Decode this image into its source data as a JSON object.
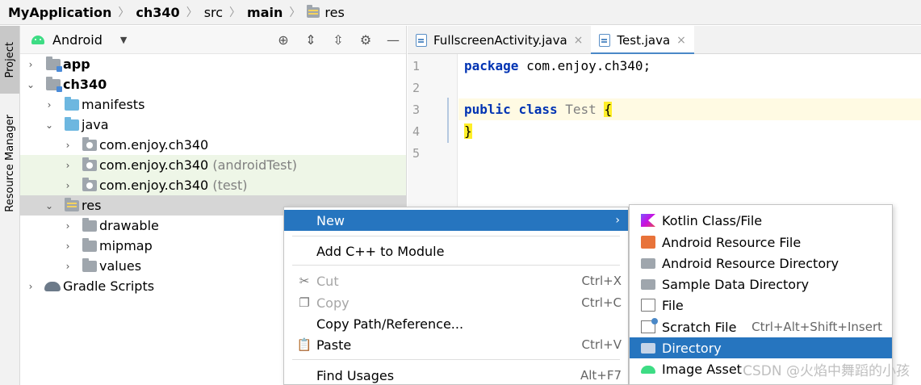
{
  "breadcrumb": {
    "items": [
      "MyApplication",
      "ch340",
      "src",
      "main",
      "res"
    ]
  },
  "toolstrip": {
    "project_tab": "Project",
    "resource_manager_tab": "Resource Manager"
  },
  "project_panel": {
    "view_mode": "Android",
    "tree": [
      {
        "label": "app",
        "suffix": ""
      },
      {
        "label": "ch340",
        "suffix": ""
      },
      {
        "label": "manifests",
        "suffix": ""
      },
      {
        "label": "java",
        "suffix": ""
      },
      {
        "label": "com.enjoy.ch340",
        "suffix": ""
      },
      {
        "label": "com.enjoy.ch340",
        "suffix": " (androidTest)"
      },
      {
        "label": "com.enjoy.ch340",
        "suffix": " (test)"
      },
      {
        "label": "res",
        "suffix": ""
      },
      {
        "label": "drawable",
        "suffix": ""
      },
      {
        "label": "mipmap",
        "suffix": ""
      },
      {
        "label": "values",
        "suffix": ""
      },
      {
        "label": "Gradle Scripts",
        "suffix": ""
      }
    ]
  },
  "editor": {
    "tabs": [
      {
        "label": "FullscreenActivity.java",
        "close": "×"
      },
      {
        "label": "Test.java",
        "close": "×"
      }
    ],
    "line_numbers": [
      "1",
      "2",
      "3",
      "4",
      "5"
    ],
    "code": {
      "l1_kw": "package",
      "l1_rest": " com.enjoy.ch340;",
      "l3_kw1": "public",
      "l3_kw2": "class",
      "l3_name": "Test",
      "l3_brace": "{",
      "l4_brace": "}"
    }
  },
  "context_menu": {
    "items": [
      {
        "label": "New",
        "shortcut": "",
        "arrow": "›"
      },
      {
        "label": "Add C++ to Module",
        "shortcut": ""
      },
      {
        "label": "Cut",
        "shortcut": "Ctrl+X"
      },
      {
        "label": "Copy",
        "shortcut": "Ctrl+C"
      },
      {
        "label": "Copy Path/Reference...",
        "shortcut": ""
      },
      {
        "label": "Paste",
        "shortcut": "Ctrl+V"
      },
      {
        "label": "Find Usages",
        "shortcut": "Alt+F7"
      }
    ]
  },
  "submenu": {
    "items": [
      {
        "label": "Kotlin Class/File",
        "shortcut": ""
      },
      {
        "label": "Android Resource File",
        "shortcut": ""
      },
      {
        "label": "Android Resource Directory",
        "shortcut": ""
      },
      {
        "label": "Sample Data Directory",
        "shortcut": ""
      },
      {
        "label": "File",
        "shortcut": ""
      },
      {
        "label": "Scratch File",
        "shortcut": "Ctrl+Alt+Shift+Insert"
      },
      {
        "label": "Directory",
        "shortcut": ""
      },
      {
        "label": "Image Asset",
        "shortcut": ""
      }
    ]
  },
  "watermark": "CSDN @火焰中舞蹈的小孩",
  "colors": {
    "selection": "#2675bf",
    "keyword": "#0033b3",
    "test_source_bg": "#eef6e7"
  }
}
